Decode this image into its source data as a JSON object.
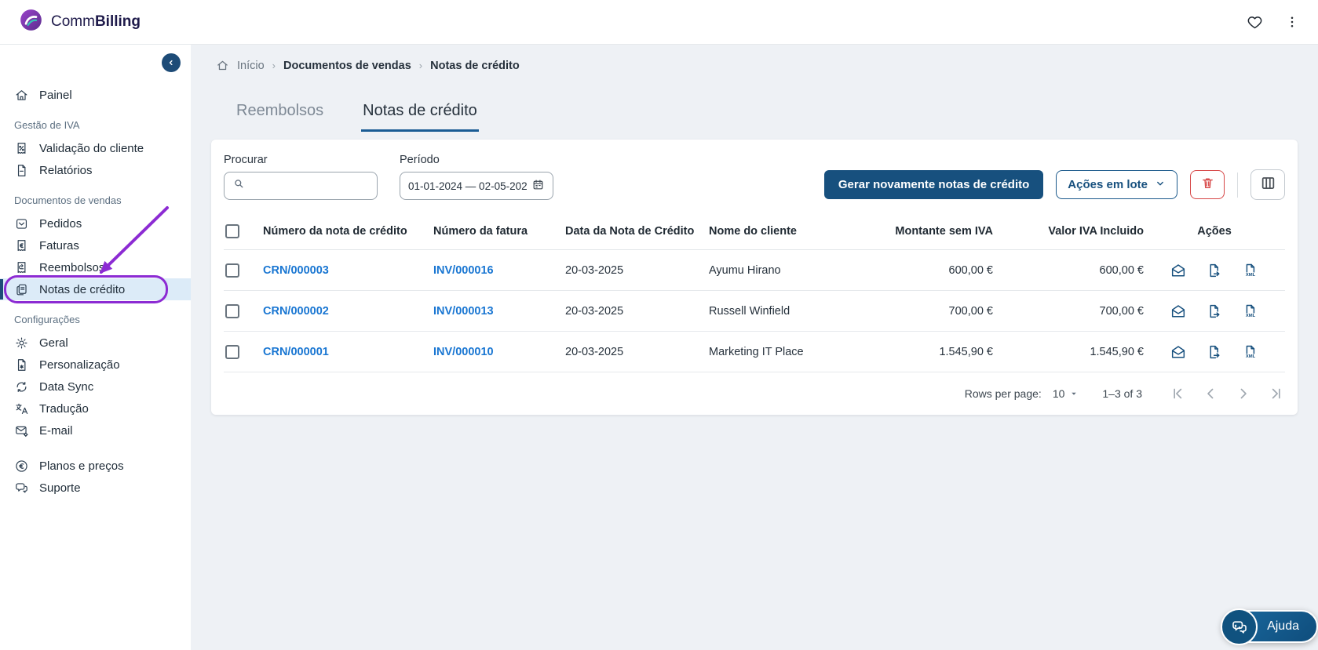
{
  "topbar": {
    "brand_prefix": "Comm",
    "brand_suffix": "Billing",
    "icons": [
      "heart-icon",
      "kebab-menu-icon"
    ]
  },
  "breadcrumb": {
    "home_icon": "home",
    "items": [
      "Início",
      "Documentos de vendas",
      "Notas de crédito"
    ]
  },
  "tabs": [
    {
      "label": "Reembolsos",
      "active": false
    },
    {
      "label": "Notas de crédito",
      "active": true
    }
  ],
  "sidebar": {
    "collapse_icon": "chevron-left",
    "sections": [
      {
        "label": "Gestão de IVA"
      },
      {
        "label": "Documentos de vendas"
      },
      {
        "label": "Configurações"
      }
    ],
    "items": [
      {
        "label": "Painel",
        "icon": "home"
      },
      {
        "label": "Validação do cliente",
        "icon": "receipt-percent"
      },
      {
        "label": "Relatórios",
        "icon": "document"
      },
      {
        "label": "Pedidos",
        "icon": "inbox"
      },
      {
        "label": "Faturas",
        "icon": "receipt-euro"
      },
      {
        "label": "Reembolsos",
        "icon": "receipt-return"
      },
      {
        "label": "Notas de crédito",
        "icon": "credit-notes",
        "active": true
      },
      {
        "label": "Geral",
        "icon": "gear"
      },
      {
        "label": "Personalização",
        "icon": "document-gear"
      },
      {
        "label": "Data Sync",
        "icon": "sync"
      },
      {
        "label": "Tradução",
        "icon": "translate"
      },
      {
        "label": "E-mail",
        "icon": "email-gear"
      },
      {
        "label": "Planos e preços",
        "icon": "euro-circle"
      },
      {
        "label": "Suporte",
        "icon": "chat"
      }
    ],
    "annotation": {
      "shape": "purple-arrow-and-ring",
      "target": "Notas de crédito"
    }
  },
  "filters": {
    "search_label": "Procurar",
    "search_value": "",
    "search_icon": "magnifier",
    "period_label": "Período",
    "period_value": "01-01-2024 — 02-05-202",
    "period_icon": "calendar"
  },
  "toolbar": {
    "regenerate_label": "Gerar novamente notas de crédito",
    "batch_actions_label": "Ações em lote",
    "batch_actions_icon": "chevron-down",
    "delete_icon": "trash",
    "columns_icon": "columns"
  },
  "table": {
    "headers": [
      "Número da nota de crédito",
      "Número da fatura",
      "Data da Nota de Crédito",
      "Nome do cliente",
      "Montante sem IVA",
      "Valor IVA Incluido",
      "Ações"
    ],
    "row_action_icons": [
      "send-email",
      "export-document",
      "download-xml"
    ],
    "rows": [
      {
        "credit_note_number": "CRN/000003",
        "invoice_number": "INV/000016",
        "date": "20-03-2025",
        "client": "Ayumu Hirano",
        "amount_without_vat": "600,00 €",
        "amount_with_vat": "600,00 €"
      },
      {
        "credit_note_number": "CRN/000002",
        "invoice_number": "INV/000013",
        "date": "20-03-2025",
        "client": "Russell Winfield",
        "amount_without_vat": "700,00 €",
        "amount_with_vat": "700,00 €"
      },
      {
        "credit_note_number": "CRN/000001",
        "invoice_number": "INV/000010",
        "date": "20-03-2025",
        "client": "Marketing IT Place",
        "amount_without_vat": "1.545,90 €",
        "amount_with_vat": "1.545,90 €"
      }
    ]
  },
  "pagination": {
    "rows_per_page_label": "Rows per page:",
    "rows_per_page_value": "10",
    "range_label": "1–3 of 3",
    "nav_icons": [
      "first-page",
      "previous-page",
      "next-page",
      "last-page"
    ]
  },
  "help": {
    "label": "Ajuda",
    "icon": "chat"
  },
  "colors": {
    "primary_blue": "#17507E",
    "link_blue": "#1976D2",
    "annotation_purple": "#8C2BD3",
    "active_item_bg": "#DCEBF8",
    "danger_red": "#D64545",
    "page_bg": "#EEF1F5",
    "tab_underline": "#1A5C94"
  }
}
